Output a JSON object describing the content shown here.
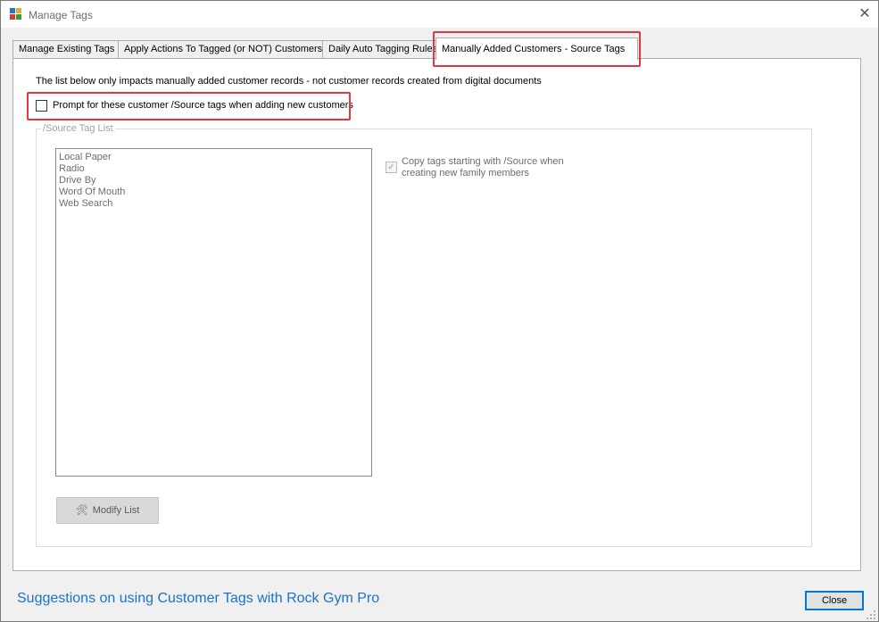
{
  "window": {
    "title": "Manage Tags",
    "close_glyph": "✕"
  },
  "tabs": [
    {
      "label": "Manage Existing Tags"
    },
    {
      "label": "Apply Actions To Tagged (or NOT) Customers"
    },
    {
      "label": "Daily Auto Tagging Rules"
    },
    {
      "label": "Manually Added Customers - Source Tags",
      "active": true
    }
  ],
  "page": {
    "info_text": "The list below only impacts manually added customer records - not customer records created from digital documents",
    "prompt_checkbox": {
      "label": "Prompt for these customer /Source tags when adding new customers",
      "checked": false
    },
    "group": {
      "legend": "/Source Tag List",
      "items": [
        "Local Paper",
        "Radio",
        "Drive By",
        "Word Of Mouth",
        "Web Search"
      ],
      "copy_checkbox": {
        "label_line1": "Copy tags starting with /Source when",
        "label_line2": "creating new family members",
        "checked": true,
        "check_glyph": "✓"
      },
      "modify_button": {
        "label": "Modify List",
        "icon": "wrench-icon",
        "glyph": "🛠"
      }
    }
  },
  "footer": {
    "link_text": "Suggestions on using Customer Tags with Rock Gym Pro",
    "close_label": "Close"
  },
  "colors": {
    "highlight": "#e5373f",
    "link": "#1a73c8",
    "focus_border": "#0078d7"
  }
}
